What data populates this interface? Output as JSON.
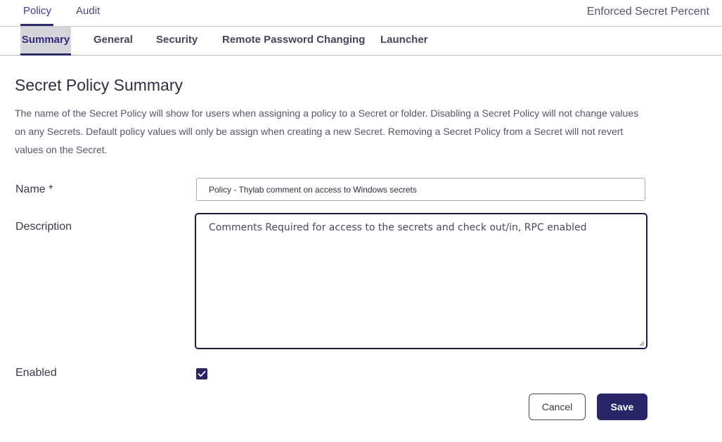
{
  "top_tabs": [
    {
      "label": "Policy",
      "active": true
    },
    {
      "label": "Audit",
      "active": false
    }
  ],
  "header_right": "Enforced Secret Percent",
  "sub_tabs": [
    {
      "label": "Summary",
      "active": true
    },
    {
      "label": "General",
      "active": false
    },
    {
      "label": "Security",
      "active": false
    },
    {
      "label": "Remote Password Changing",
      "active": false
    },
    {
      "label": "Launcher",
      "active": false
    }
  ],
  "page": {
    "title": "Secret Policy Summary",
    "description": "The name of the Secret Policy will show for users when assigning a policy to a Secret or folder. Disabling a Secret Policy will not change values on any Secrets. Default policy values will only be assign when creating a new Secret. Removing a Secret Policy from a Secret will not revert values on the Secret."
  },
  "form": {
    "name_label": "Name *",
    "name_value": "Policy - Thylab comment on access to Windows secrets",
    "description_label": "Description",
    "description_value": "Comments Required for access to the secrets and check out/in, RPC enabled",
    "enabled_label": "Enabled",
    "enabled_checked": true
  },
  "buttons": {
    "cancel": "Cancel",
    "save": "Save"
  },
  "colors": {
    "accent": "#2a2566",
    "active_tab_bg": "#d4d4da"
  },
  "icons": {
    "checkbox": "check-icon",
    "resize": "resize-grip-icon"
  }
}
